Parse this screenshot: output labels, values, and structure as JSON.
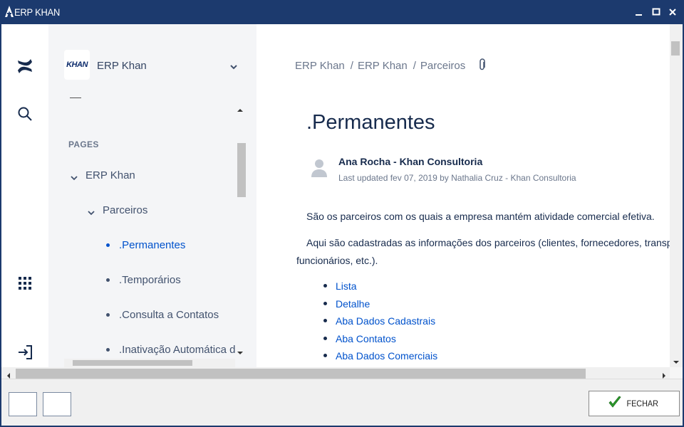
{
  "window": {
    "title": "ERP KHAN",
    "controls": [
      "minimize-icon",
      "maximize-icon",
      "close-icon"
    ]
  },
  "leftbar": {
    "icons": [
      "confluence-logo-icon",
      "search-icon",
      "apps-grid-icon",
      "sign-in-icon"
    ]
  },
  "sidebar": {
    "space_logo_text": "KHAN",
    "space_name": "ERP Khan",
    "pages_heading": "PAGES",
    "tree": [
      {
        "label": "ERP Khan",
        "level": 0,
        "expanded": true
      },
      {
        "label": "Parceiros",
        "level": 1,
        "expanded": true
      },
      {
        "label": ".Permanentes",
        "level": 2,
        "active": true
      },
      {
        "label": ".Temporários",
        "level": 2
      },
      {
        "label": ".Consulta a Contatos",
        "level": 2
      },
      {
        "label": ".Inativação Automática de",
        "level": 2
      }
    ]
  },
  "main": {
    "breadcrumb": [
      "ERP Khan",
      "ERP Khan",
      "Parceiros"
    ],
    "breadcrumb_sep": "/",
    "title": ".Permanentes",
    "author": "Ana Rocha - Khan Consultoria",
    "updated": "Last updated fev 07, 2019 by Nathalia Cruz - Khan Consultoria",
    "para1": "São os parceiros com os quais a empresa mantém atividade comercial efetiva.",
    "para2_line1": "Aqui são cadastradas as informações dos parceiros (clientes, fornecedores, transporta",
    "para2_line2": "funcionários, etc.).",
    "links": [
      "Lista",
      "Detalhe",
      "Aba Dados Cadastrais",
      "Aba Contatos",
      "Aba Dados Comerciais"
    ]
  },
  "footer": {
    "close_label": "FECHAR"
  },
  "colors": {
    "titlebar": "#1c3a6e",
    "link": "#0052cc",
    "sidebar_bg": "#f4f5f7",
    "check_green": "#2e9e2e"
  }
}
